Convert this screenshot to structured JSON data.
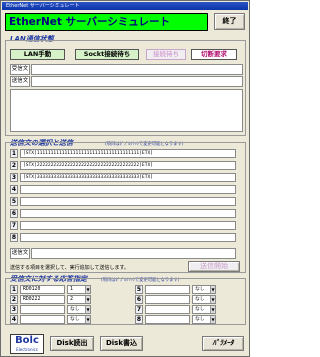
{
  "window": {
    "title": "EtherNet サーバーシミュレート"
  },
  "header": {
    "logo_text": "EtherNet サーバーシミュレート",
    "end_label": "終了"
  },
  "lan": {
    "section_title": "LAN通信状態",
    "status": [
      "LAN手動",
      "Sockt接続待ち"
    ],
    "wait_label": "接続待ち",
    "disconnect_label": "切断要求",
    "recv_label": "受信文",
    "send_label": "送信文",
    "recv_value": "",
    "send_value": ""
  },
  "send": {
    "section_title": "送信文の選択と送信",
    "note": "(項目はﾀﾞﾌﾞﾙｸﾘｯｸで変更可能となります)",
    "rows": [
      {
        "no": "1",
        "text": "[STX]1111111111111111111111111111111111111[ETX]"
      },
      {
        "no": "2",
        "text": "[STX]2222222222222222222222222222222222222[ETX]"
      },
      {
        "no": "3",
        "text": "[STX]3333333333333333333333333333333333333[ETX]"
      },
      {
        "no": "4",
        "text": ""
      },
      {
        "no": "5",
        "text": ""
      },
      {
        "no": "6",
        "text": ""
      },
      {
        "no": "7",
        "text": ""
      },
      {
        "no": "8",
        "text": ""
      }
    ],
    "sent_label": "送信文",
    "hint": "送信する項目を選択して、実行追加して送信します。",
    "send_start_label": "送信開始"
  },
  "resp": {
    "section_title": "受信文に対する応答指定",
    "note": "(項目はﾀﾞﾌﾞﾙｸﾘｯｸで変更可能となります)",
    "left": [
      {
        "no": "1",
        "cmd": "RD0120",
        "sel": "1"
      },
      {
        "no": "2",
        "cmd": "RD0222",
        "sel": "2"
      },
      {
        "no": "3",
        "cmd": "",
        "sel": "なし"
      },
      {
        "no": "4",
        "cmd": "",
        "sel": "なし"
      }
    ],
    "right": [
      {
        "no": "5",
        "cmd": "",
        "sel": "なし"
      },
      {
        "no": "6",
        "cmd": "",
        "sel": "なし"
      },
      {
        "no": "7",
        "cmd": "",
        "sel": "なし"
      },
      {
        "no": "8",
        "cmd": "",
        "sel": "なし"
      }
    ]
  },
  "footer": {
    "brand": "Bolc",
    "brand_sub": "Electronics",
    "disk_read_label": "Disk読出",
    "disk_write_label": "Disk書込",
    "param_label": "ﾊﾟﾗﾒｰﾀ"
  },
  "colors": {
    "logo_bg": "#00ff00",
    "logo_text": "#000080",
    "section_title": "#1f38a0",
    "status_bg": "#d7f2c9",
    "disconnect_text": "#b01070"
  }
}
